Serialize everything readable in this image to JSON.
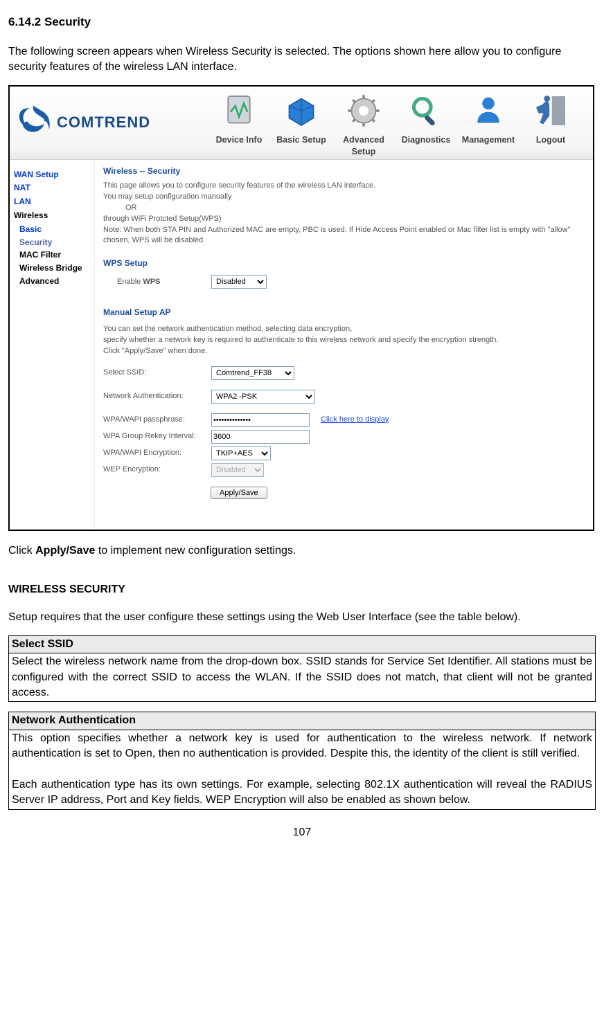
{
  "section_title": "6.14.2 Security",
  "intro": "The following screen appears when Wireless Security is selected. The options shown here allow you to configure security features of the wireless LAN interface.",
  "screenshot": {
    "logo_text": "COMTREND",
    "nav": [
      {
        "label": "Device Info"
      },
      {
        "label": "Basic Setup"
      },
      {
        "label": "Advanced Setup"
      },
      {
        "label": "Diagnostics"
      },
      {
        "label": "Management"
      },
      {
        "label": "Logout"
      }
    ],
    "sidebar": {
      "items": [
        {
          "label": "WAN Setup",
          "class": "top"
        },
        {
          "label": "NAT",
          "class": "top"
        },
        {
          "label": "LAN",
          "class": "top"
        },
        {
          "label": "Wireless",
          "class": "top sel"
        },
        {
          "label": "Basic",
          "class": "sub"
        },
        {
          "label": "Security",
          "class": "sub active"
        },
        {
          "label": "MAC Filter",
          "class": "sub"
        },
        {
          "label": "Wireless Bridge",
          "class": "sub"
        },
        {
          "label": "Advanced",
          "class": "sub"
        }
      ]
    },
    "content": {
      "title": "Wireless -- Security",
      "p1": "This page allows you to configure security features of the wireless LAN interface.",
      "p2": "You may setup configuration manually",
      "or": "OR",
      "p3": "through WiFi Protcted Setup(WPS)",
      "p4": "Note: When both STA PIN and Authorized MAC are empty, PBC is used. If Hide Access Point enabled or Mac filter list is empty with \"allow\" chosen, WPS will be disabled",
      "wps_h": "WPS Setup",
      "wps_label": "Enable",
      "wps_bold": "WPS",
      "wps_select": "Disabled",
      "manual_h": "Manual Setup AP",
      "m1": "You can set the network authentication method, selecting data encryption,",
      "m2": "specify whether a network key is required to authenticate to this wireless network and specify the encryption strength.",
      "m3": "Click \"Apply/Save\" when done.",
      "ssid_lbl": "Select SSID:",
      "ssid_val": "Comtrend_FF38",
      "auth_lbl": "Network Authentication:",
      "auth_val": "WPA2 -PSK",
      "pass_lbl": "WPA/WAPI passphrase:",
      "pass_val": "••••••••••••••",
      "pass_link": "Click here to display",
      "rekey_lbl": "WPA Group Rekey Interval:",
      "rekey_val": "3600",
      "enc_lbl": "WPA/WAPI Encryption:",
      "enc_val": "TKIP+AES",
      "wep_lbl": "WEP Encryption:",
      "wep_val": "Disabled",
      "apply": "Apply/Save"
    }
  },
  "post_shot_pre": "Click ",
  "post_shot_bold": "Apply/Save",
  "post_shot_post": " to implement new configuration settings.",
  "wireless_h": "WIRELESS SECURITY",
  "setup_text": "Setup requires that the user configure these settings using the Web User Interface (see the table below).",
  "table1": {
    "header": "Select SSID",
    "body": "Select the wireless network name from the drop-down box. SSID stands for Service Set Identifier.   All stations must be configured with the correct SSID to access the WLAN. If the SSID does not match, that client will not be granted access."
  },
  "table2": {
    "header": "Network Authentication",
    "body1": "This option specifies whether a network key is used for authentication to the wireless network.   If network authentication is set to Open, then no authentication is provided.   Despite this, the identity of the client is still verified.",
    "body2": "Each authentication type has its own settings.   For example, selecting 802.1X authentication will reveal the RADIUS Server IP address, Port and Key fields.   WEP Encryption will also be enabled as shown below."
  },
  "page_number": "107"
}
